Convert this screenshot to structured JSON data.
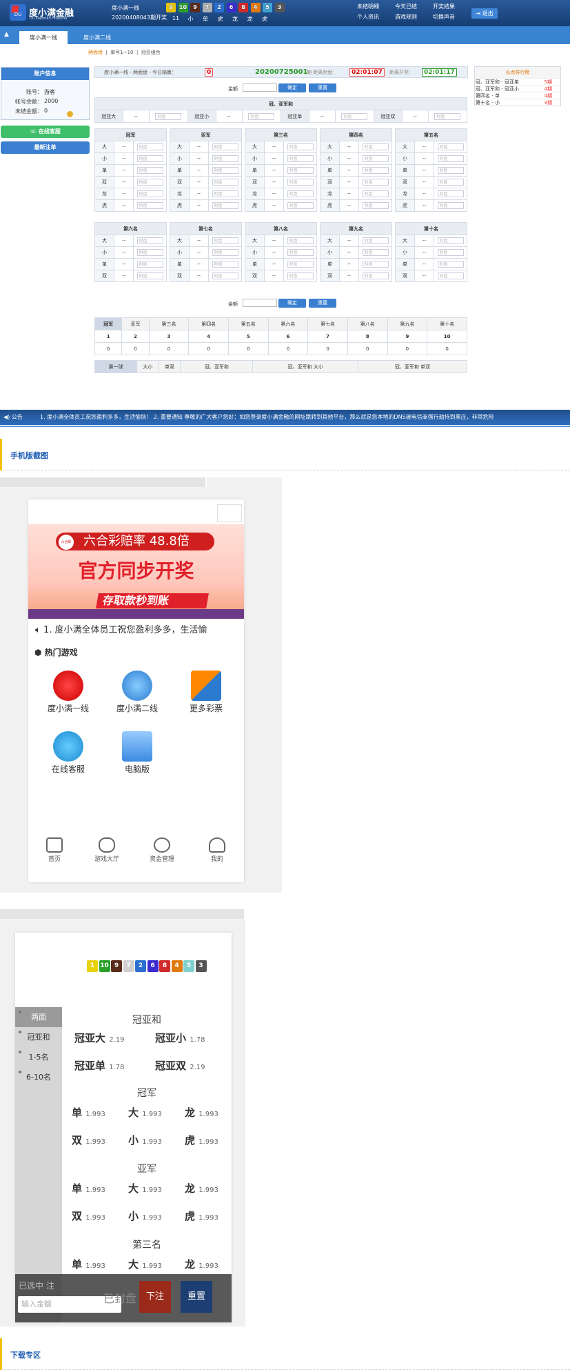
{
  "header": {
    "logo_cn": "度小满金融",
    "logo_en": "Du Xiaoman Financial",
    "game_name": "度小满一线",
    "issue": "20200408043期开奖",
    "balls": [
      {
        "n": "9",
        "c": "#e8c40e"
      },
      {
        "n": "10",
        "c": "#2aa02a"
      },
      {
        "n": "9",
        "c": "#5a2a1a"
      },
      {
        "n": "7",
        "c": "#b0b0b0"
      },
      {
        "n": "2",
        "c": "#2a6fd0"
      },
      {
        "n": "6",
        "c": "#3a2ad0"
      },
      {
        "n": "8",
        "c": "#d02a2a"
      },
      {
        "n": "4",
        "c": "#e07a10"
      },
      {
        "n": "5",
        "c": "#40a0d0"
      },
      {
        "n": "3",
        "c": "#555555"
      }
    ],
    "ball_labels": [
      "11",
      "小",
      "单",
      "虎",
      "龙",
      "龙",
      "虎"
    ],
    "links_row1": [
      "未结明细",
      "今天已结",
      "开奖结果"
    ],
    "links_row2": [
      "个人资讯",
      "游戏规则",
      "切换声音"
    ],
    "logout": "退出"
  },
  "nav": {
    "tabs": [
      "度小满一线",
      "度小满二线"
    ]
  },
  "subnav": {
    "items": [
      "两面盘",
      "单号1~10",
      "冠亚组合"
    ]
  },
  "account": {
    "title": "账户信息",
    "account_label": "账号：",
    "account_value": "游客",
    "balance_label": "帐号余额：",
    "balance_value": "2000",
    "unsettled_label": "未结金额：",
    "unsettled_value": "0",
    "service_btn": "在线客服",
    "latest_btn": "最新注单"
  },
  "infobar": {
    "crumb": "度小满一线 - 两面盘 - 今日输赢：",
    "today": "0",
    "issue": "20200725001",
    "close_label": "期 距离封盘：",
    "close_time": "02:01:07",
    "open_label": "距离开奖：",
    "open_time": "02:01:17"
  },
  "amount": {
    "label": "金额",
    "ok": "确定",
    "reset": "重置"
  },
  "gy": {
    "title": "冠、亚军和",
    "items": [
      {
        "k": "冠亚大",
        "v": "--"
      },
      {
        "k": "冠亚小",
        "v": "--"
      },
      {
        "k": "冠亚单",
        "v": "--"
      },
      {
        "k": "冠亚双",
        "v": "--"
      }
    ],
    "placeholder": "财盘"
  },
  "rank_row1": [
    {
      "title": "冠军",
      "rows": [
        "大",
        "小",
        "单",
        "双",
        "龙",
        "虎"
      ]
    },
    {
      "title": "亚军",
      "rows": [
        "大",
        "小",
        "单",
        "双",
        "龙",
        "虎"
      ]
    },
    {
      "title": "第三名",
      "rows": [
        "大",
        "小",
        "单",
        "双",
        "龙",
        "虎"
      ]
    },
    {
      "title": "第四名",
      "rows": [
        "大",
        "小",
        "单",
        "双",
        "龙",
        "虎"
      ]
    },
    {
      "title": "第五名",
      "rows": [
        "大",
        "小",
        "单",
        "双",
        "龙",
        "虎"
      ]
    }
  ],
  "rank_row2": [
    {
      "title": "第六名",
      "rows": [
        "大",
        "小",
        "单",
        "双"
      ]
    },
    {
      "title": "第七名",
      "rows": [
        "大",
        "小",
        "单",
        "双"
      ]
    },
    {
      "title": "第八名",
      "rows": [
        "大",
        "小",
        "单",
        "双"
      ]
    },
    {
      "title": "第九名",
      "rows": [
        "大",
        "小",
        "单",
        "双"
      ]
    },
    {
      "title": "第十名",
      "rows": [
        "大",
        "小",
        "单",
        "双"
      ]
    }
  ],
  "dash": "--",
  "placeholder": "财盘",
  "stats": {
    "tabs": [
      "冠军",
      "亚军",
      "第三名",
      "第四名",
      "第五名",
      "第六名",
      "第七名",
      "第八名",
      "第九名",
      "第十名"
    ],
    "nums": [
      "1",
      "2",
      "3",
      "4",
      "5",
      "6",
      "7",
      "8",
      "9",
      "10"
    ],
    "vals": [
      "0",
      "0",
      "0",
      "0",
      "0",
      "0",
      "0",
      "0",
      "0",
      "0"
    ],
    "subtabs": [
      "第一球",
      "大小",
      "单双",
      "冠、亚军和",
      "冠、亚军和 大小",
      "冠、亚军和 单双"
    ]
  },
  "longdragon": {
    "title": "长龙排行榜",
    "items": [
      {
        "k": "冠、亚军和 - 冠亚单",
        "v": "5期"
      },
      {
        "k": "冠、亚军和 - 冠亚小",
        "v": "4期"
      },
      {
        "k": "第四名 - 单",
        "v": "4期"
      },
      {
        "k": "第十名 - 小",
        "v": "3期"
      }
    ]
  },
  "bulletin": {
    "label": "公告",
    "text": "1. 度小满全体员工祝您盈利多多，生活愉快！  2. 重要通知 尊敬的广大客户您好：如您登录度小满金融的网址跳转到其他平台，那么就是您本地的DNS被电信商强行劫持到黑庄，非常危险"
  },
  "section1": "手机版截图",
  "section2": "下载专区",
  "phone1": {
    "rate": "六合彩赔率  48.8倍",
    "main": "官方同步开奖",
    "strip": "存取款秒到账",
    "news": "1. 度小满全体员工祝您盈利多多，生活愉",
    "hot": "热门游戏",
    "games": [
      "度小满一线",
      "度小满二线",
      "更多彩票",
      "在线客服",
      "电脑版"
    ],
    "tabs": [
      "首页",
      "游戏大厅",
      "资金管理",
      "我的"
    ]
  },
  "phone2": {
    "balls": [
      {
        "n": "1",
        "c": "#e8d20e"
      },
      {
        "n": "10",
        "c": "#2aa02a"
      },
      {
        "n": "9",
        "c": "#5a2a1a"
      },
      {
        "n": "7",
        "c": "#d0d0d0"
      },
      {
        "n": "2",
        "c": "#2a6fd0"
      },
      {
        "n": "6",
        "c": "#3a2ad0"
      },
      {
        "n": "8",
        "c": "#d02a2a"
      },
      {
        "n": "4",
        "c": "#e07a10"
      },
      {
        "n": "5",
        "c": "#80d0d0"
      },
      {
        "n": "3",
        "c": "#555555"
      }
    ],
    "side": [
      "两面",
      "冠亚和",
      "1-5名",
      "6-10名"
    ],
    "gy_title": "冠亚和",
    "gy": [
      {
        "k": "冠亚大",
        "v": "2.19"
      },
      {
        "k": "冠亚小",
        "v": "1.78"
      },
      {
        "k": "冠亚单",
        "v": "1.78"
      },
      {
        "k": "冠亚双",
        "v": "2.19"
      }
    ],
    "groups": [
      {
        "t": "冠军",
        "o": [
          {
            "k": "单",
            "v": "1.993"
          },
          {
            "k": "大",
            "v": "1.993"
          },
          {
            "k": "龙",
            "v": "1.993"
          },
          {
            "k": "双",
            "v": "1.993"
          },
          {
            "k": "小",
            "v": "1.993"
          },
          {
            "k": "虎",
            "v": "1.993"
          }
        ]
      },
      {
        "t": "亚军",
        "o": [
          {
            "k": "单",
            "v": "1.993"
          },
          {
            "k": "大",
            "v": "1.993"
          },
          {
            "k": "龙",
            "v": "1.993"
          },
          {
            "k": "双",
            "v": "1.993"
          },
          {
            "k": "小",
            "v": "1.993"
          },
          {
            "k": "虎",
            "v": "1.993"
          }
        ]
      },
      {
        "t": "第三名",
        "o": [
          {
            "k": "单",
            "v": "1.993"
          },
          {
            "k": "大",
            "v": "1.993"
          },
          {
            "k": "龙",
            "v": "1.993"
          }
        ]
      }
    ],
    "selected": "已选中 注",
    "input": "输入金额",
    "closed": "已封盘",
    "bet": "下注",
    "reset": "重置"
  }
}
